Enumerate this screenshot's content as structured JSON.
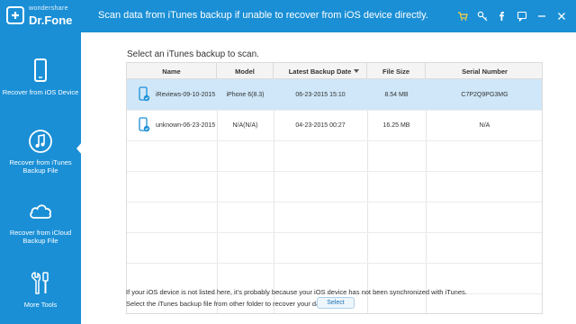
{
  "app": {
    "brand_small": "wondershare",
    "brand_name": "Dr.Fone",
    "headline": "Scan data from iTunes backup if unable to recover from iOS device directly."
  },
  "titlebar_icons": [
    "cart-icon",
    "key-icon",
    "facebook-icon",
    "feedback-icon",
    "minimize-icon",
    "close-icon"
  ],
  "sidebar": {
    "items": [
      {
        "label": "Recover from iOS Device",
        "icon": "phone-icon",
        "active": false
      },
      {
        "label": "Recover from iTunes Backup File",
        "icon": "music-note-icon",
        "active": true
      },
      {
        "label": "Recover from iCloud Backup File",
        "icon": "cloud-icon",
        "active": false
      },
      {
        "label": "More Tools",
        "icon": "tools-icon",
        "active": false
      }
    ]
  },
  "main": {
    "instruction": "Select an iTunes backup to scan.",
    "columns": [
      "Name",
      "Model",
      "Latest Backup Date",
      "File Size",
      "Serial Number"
    ],
    "sorted_column": "Latest Backup Date",
    "rows": [
      {
        "name": "iReviews-09-10-2015 ...",
        "model": "iPhone 6(8.3)",
        "date": "06-23-2015 15:10",
        "size": "8.54 MB",
        "serial": "C7P2Q9PG3MG",
        "selected": true
      },
      {
        "name": "unknown-06-23-2015 ...",
        "model": "N/A(N/A)",
        "date": "04-23-2015 00:27",
        "size": "16.25 MB",
        "serial": "N/A",
        "selected": false
      }
    ],
    "note1": "If your iOS device is not listed here, it's probably because your iOS device has not been synchronized with iTunes.",
    "note2": "Select the iTunes backup file from other folder to recover your data.",
    "select_label": "Select"
  },
  "colors": {
    "accent": "#1a8fd6",
    "selected_row": "#cfe7f8"
  }
}
